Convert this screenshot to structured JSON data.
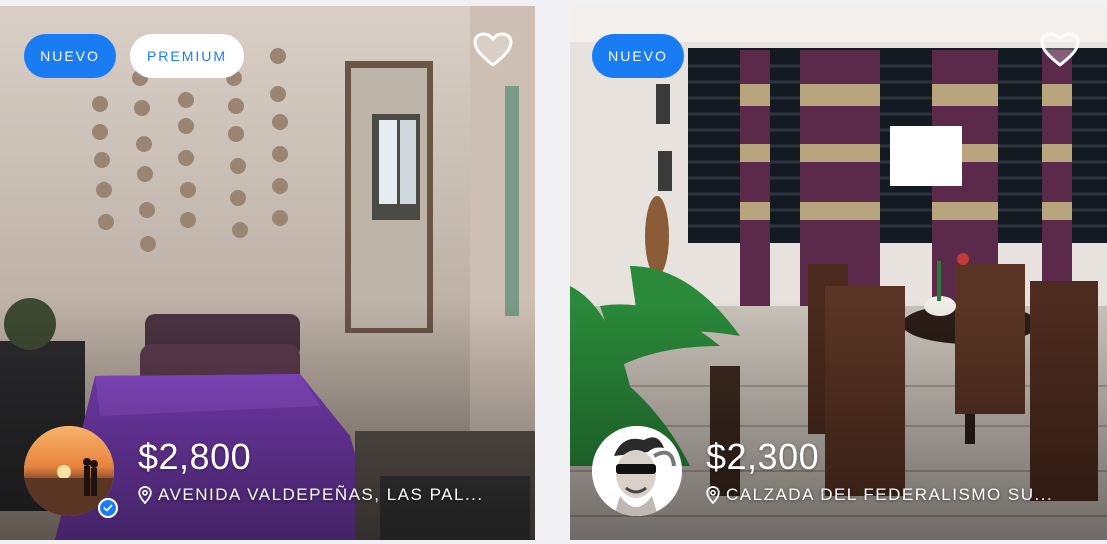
{
  "listings": [
    {
      "badges": [
        "NUEVO",
        "PREMIUM"
      ],
      "price": "$2,800",
      "address": "AVENIDA VALDEPEÑAS, LAS PAL...",
      "favorite_icon": "heart-outline-icon",
      "avatar_verified": true
    },
    {
      "badges": [
        "NUEVO"
      ],
      "price": "$2,300",
      "address": "CALZADA DEL FEDERALISMO SU...",
      "favorite_icon": "heart-outline-icon",
      "avatar_verified": false
    }
  ],
  "colors": {
    "accent": "#1a7cf2",
    "badge_text_light": "#ffffff",
    "page_bg": "#f1f1f3"
  }
}
